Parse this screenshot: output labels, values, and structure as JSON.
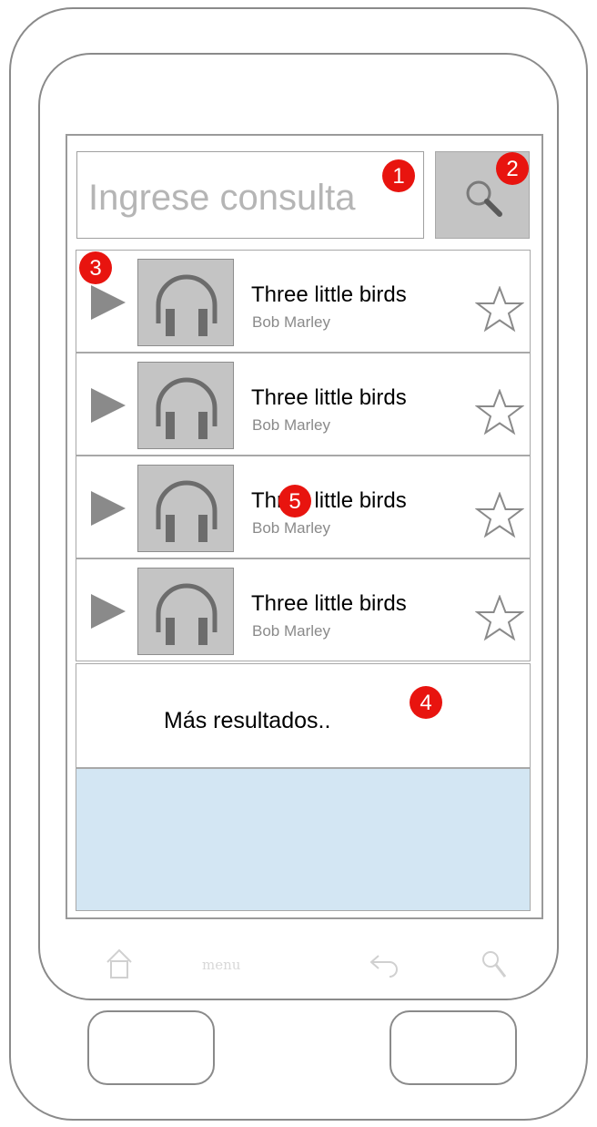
{
  "search": {
    "placeholder": "Ingrese consulta",
    "button_icon": "search-icon"
  },
  "results": [
    {
      "title": "Three little birds",
      "artist": "Bob Marley"
    },
    {
      "title": "Three little birds",
      "artist": "Bob Marley"
    },
    {
      "title": "Three little birds",
      "artist": "Bob Marley"
    },
    {
      "title": "Three little birds",
      "artist": "Bob Marley"
    }
  ],
  "more_results": "Más resultados..",
  "softkeys": {
    "home_icon": "home-icon",
    "menu_label": "menu",
    "back_icon": "back-icon",
    "search_icon": "search-icon"
  },
  "markers": [
    "1",
    "2",
    "3",
    "4",
    "5"
  ],
  "colors": {
    "marker": "#e8140f",
    "empty_area": "#d3e6f3",
    "icon_gray": "#8a8a8a"
  }
}
